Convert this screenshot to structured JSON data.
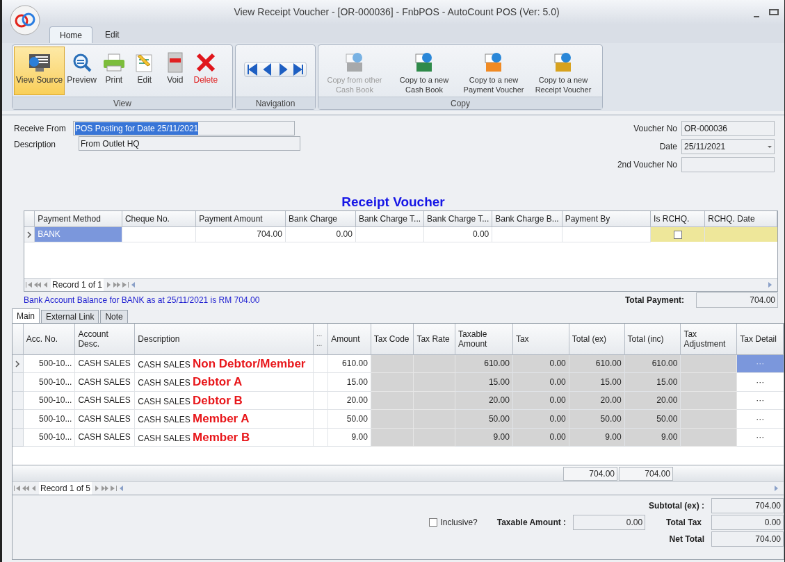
{
  "window": {
    "title": "View Receipt Voucher - [OR-000036] - FnbPOS - AutoCount POS (Ver: 5.0)"
  },
  "ribbon": {
    "tabs": [
      {
        "label": "Home",
        "selected": true
      },
      {
        "label": "Edit",
        "selected": false
      }
    ],
    "groups": [
      {
        "label": "View",
        "kind": "buttons",
        "buttons": [
          {
            "label": "View Source",
            "selected": true,
            "disabled": false,
            "kind": "normal"
          },
          {
            "label": "Preview",
            "selected": false,
            "disabled": false,
            "kind": "normal"
          },
          {
            "label": "Print",
            "selected": false,
            "disabled": false,
            "kind": "normal"
          },
          {
            "label": "Edit",
            "selected": false,
            "disabled": false,
            "kind": "normal"
          },
          {
            "label": "Void",
            "selected": false,
            "disabled": false,
            "kind": "normal"
          },
          {
            "label": "Delete",
            "selected": false,
            "disabled": false,
            "kind": "danger"
          }
        ]
      },
      {
        "label": "Navigation",
        "kind": "navigation"
      },
      {
        "label": "Copy",
        "kind": "buttons",
        "buttons": [
          {
            "label": "Copy from other Cash Book",
            "selected": false,
            "disabled": true,
            "kind": "normal"
          },
          {
            "label": "Copy to a new Cash Book",
            "selected": false,
            "disabled": false,
            "kind": "normal"
          },
          {
            "label": "Copy to a new Payment Voucher",
            "selected": false,
            "disabled": false,
            "kind": "normal"
          },
          {
            "label": "Copy to a new Receipt Voucher",
            "selected": false,
            "disabled": false,
            "kind": "normal"
          }
        ]
      }
    ]
  },
  "form": {
    "left": [
      {
        "label": "Receive From",
        "value": "POS Posting for Date 25/11/2021",
        "highlighted": true
      },
      {
        "label": "Description",
        "value": "From Outlet HQ",
        "highlighted": false
      }
    ],
    "right": [
      {
        "label": "Voucher No",
        "value": "OR-000036",
        "kind": "text"
      },
      {
        "label": "Date",
        "value": "25/11/2021",
        "kind": "dropdown"
      },
      {
        "label": "2nd Voucher No",
        "kind": "text"
      }
    ]
  },
  "payment": {
    "title": "Receipt Voucher",
    "columns": [
      "Payment Method",
      "Cheque No.",
      "Payment Amount",
      "Bank Charge",
      "Bank Charge T...",
      "Bank Charge T...",
      "Bank Charge B...",
      "Payment By",
      "Is RCHQ.",
      "RCHQ. Date"
    ],
    "rows": [
      {
        "selected": true,
        "payment_method": "BANK",
        "payment_amount": "704.00",
        "bank_charge": "0.00",
        "bank_charge_tax": "0.00",
        "is_rchq": false
      }
    ],
    "navigator": "Record 1 of 1",
    "balance_note": "Bank Account Balance for BANK as at 25/11/2021 is RM 704.00",
    "total": {
      "label": "Total Payment:",
      "value": "704.00"
    }
  },
  "details": {
    "tabs": [
      {
        "label": "Main",
        "selected": true
      },
      {
        "label": "External Link",
        "selected": false
      },
      {
        "label": "Note",
        "selected": false
      }
    ],
    "columns": [
      "Acc. No.",
      "Account Desc.",
      "Description",
      "... ...",
      "Amount",
      "Tax Code",
      "Tax Rate",
      "Taxable Amount",
      "Tax",
      "Total (ex)",
      "Total (inc)",
      "Tax Adjustment",
      "Tax Detail"
    ],
    "rows": [
      {
        "selected": true,
        "acc_no": "500-10...",
        "account_desc": "CASH SALES",
        "description": "CASH SALES",
        "note": "Non Debtor/Member",
        "amount": "610.00",
        "taxable_amount": "610.00",
        "tax": "0.00",
        "total_ex": "610.00",
        "total_inc": "610.00",
        "tax_detail": "···"
      },
      {
        "selected": false,
        "acc_no": "500-10...",
        "account_desc": "CASH SALES",
        "description": "CASH SALES",
        "note": "Debtor A",
        "amount": "15.00",
        "taxable_amount": "15.00",
        "tax": "0.00",
        "total_ex": "15.00",
        "total_inc": "15.00",
        "tax_detail": "···"
      },
      {
        "selected": false,
        "acc_no": "500-10...",
        "account_desc": "CASH SALES",
        "description": "CASH SALES",
        "note": "Debtor B",
        "amount": "20.00",
        "taxable_amount": "20.00",
        "tax": "0.00",
        "total_ex": "20.00",
        "total_inc": "20.00",
        "tax_detail": "···"
      },
      {
        "selected": false,
        "acc_no": "500-10...",
        "account_desc": "CASH SALES",
        "description": "CASH SALES",
        "note": "Member A",
        "amount": "50.00",
        "taxable_amount": "50.00",
        "tax": "0.00",
        "total_ex": "50.00",
        "total_inc": "50.00",
        "tax_detail": "···"
      },
      {
        "selected": false,
        "acc_no": "500-10...",
        "account_desc": "CASH SALES",
        "description": "CASH SALES",
        "note": "Member B",
        "amount": "9.00",
        "taxable_amount": "9.00",
        "tax": "0.00",
        "total_ex": "9.00",
        "total_inc": "9.00",
        "tax_detail": "···"
      }
    ],
    "footer": {
      "total_ex": "704.00",
      "total_inc": "704.00"
    },
    "navigator": "Record 1 of 5"
  },
  "summary": {
    "inclusive": {
      "label": "Inclusive?",
      "checked": false
    },
    "taxable_amount": {
      "label": "Taxable Amount :",
      "value": "0.00"
    },
    "subtotal": {
      "label": "Subtotal (ex) :",
      "value": "704.00"
    },
    "total_tax": {
      "label": "Total Tax",
      "value": "0.00"
    },
    "net_total": {
      "label": "Net Total",
      "value": "704.00"
    }
  }
}
